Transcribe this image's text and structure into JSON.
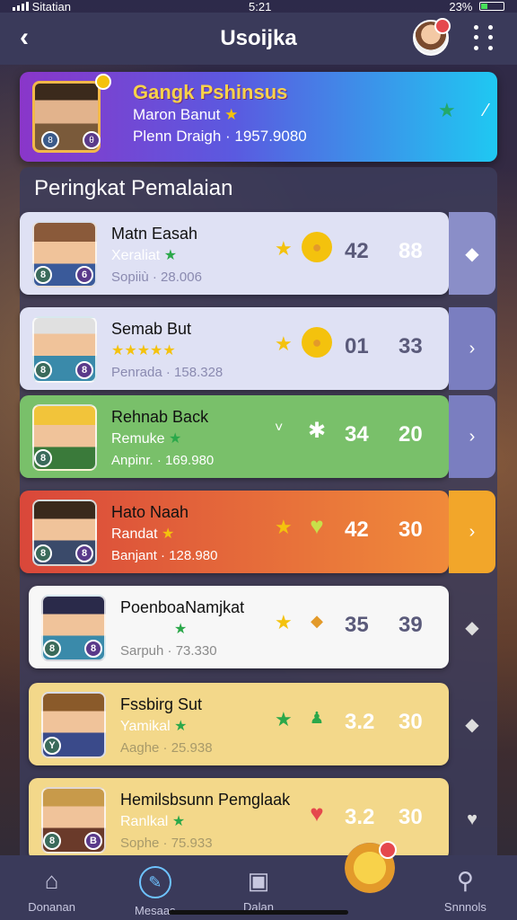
{
  "status": {
    "carrier": "Sitatian",
    "time": "5:21",
    "battery": "23%"
  },
  "header": {
    "title": "Usoijka"
  },
  "hero": {
    "title": "Gangk Pshinsus",
    "subtitle": "Maron Banut",
    "meta": "Plenn Draigh · 1957.9080",
    "badge_left": "8",
    "badge_right": "θ"
  },
  "panel": {
    "title": "Peringkat Pemalaian"
  },
  "rows": [
    {
      "name": "Matn Easah",
      "sub": "Xeraliat",
      "meta": "Sopiiù · 28.006",
      "n1": "42",
      "n2": "88",
      "b1": "8",
      "b2": "6",
      "icon1": "★",
      "icon2": "●"
    },
    {
      "name": "Semab But",
      "sub": "★★★★★",
      "meta": "Penrada · 158.328",
      "n1": "01",
      "n2": "33",
      "b1": "8",
      "b2": "8",
      "icon1": "★",
      "icon2": "●"
    },
    {
      "name": "Rehnab Back",
      "sub": "Remuke",
      "meta": "Anpinr. · 169.980",
      "n1": "34",
      "n2": "20",
      "b1": "8",
      "b2": "",
      "icon1": "˅",
      "icon2": "✱"
    },
    {
      "name": "Hato Naah",
      "sub": "Randat",
      "meta": "Banjant · 128.980",
      "n1": "42",
      "n2": "30",
      "b1": "8",
      "b2": "8",
      "icon1": "★",
      "icon2": "♥"
    },
    {
      "name": "PoenboaNamjkat",
      "sub": "",
      "meta": "Sarpuh · 73.330",
      "n1": "35",
      "n2": "39",
      "b1": "8",
      "b2": "8",
      "icon1": "★",
      "icon2": "◆"
    },
    {
      "name": "Fssbirg Sut",
      "sub": "Yamikal",
      "meta": "Aaghe · 25.938",
      "n1": "3.2",
      "n2": "30",
      "b1": "Y",
      "b2": "",
      "icon1": "★",
      "icon2": "♟"
    },
    {
      "name": "Hemilsbsunn Pemglaak",
      "sub": "Ranlkal",
      "meta": "Sophe · 75.933",
      "n1": "3.2",
      "n2": "30",
      "b1": "8",
      "b2": "B",
      "icon1": "",
      "icon2": "♥"
    }
  ],
  "nav": [
    {
      "label": "Donanan",
      "icon": "home-icon"
    },
    {
      "label": "Mesaas",
      "icon": "compass-icon"
    },
    {
      "label": "Dalan",
      "icon": "chat-icon"
    },
    {
      "label": "",
      "icon": "trophy-icon"
    },
    {
      "label": "Snnnols",
      "icon": "user-icon"
    }
  ]
}
